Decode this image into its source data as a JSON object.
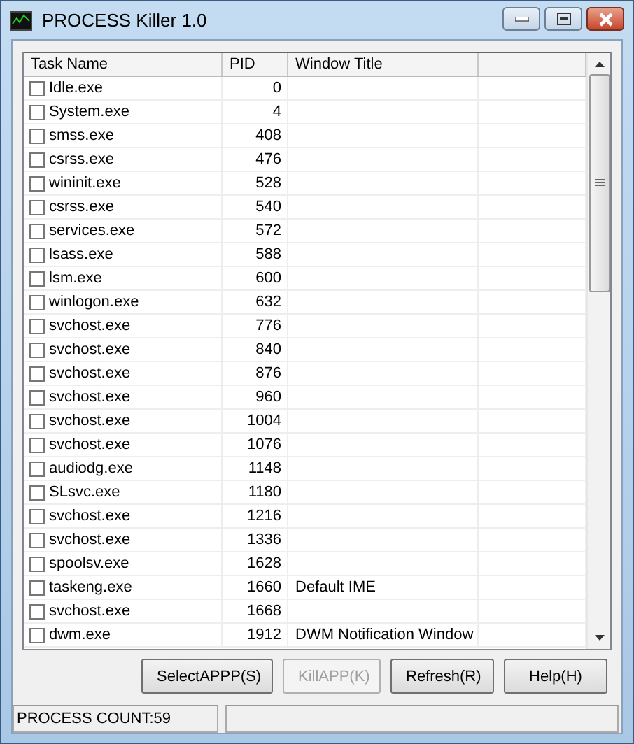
{
  "window": {
    "title": "PROCESS Killer 1.0"
  },
  "table": {
    "columns": [
      "Task Name",
      "PID",
      "Window Title"
    ],
    "rows": [
      {
        "name": "Idle.exe",
        "pid": "0",
        "title": "",
        "checked": false
      },
      {
        "name": "System.exe",
        "pid": "4",
        "title": "",
        "checked": false
      },
      {
        "name": "smss.exe",
        "pid": "408",
        "title": "",
        "checked": false
      },
      {
        "name": "csrss.exe",
        "pid": "476",
        "title": "",
        "checked": false
      },
      {
        "name": "wininit.exe",
        "pid": "528",
        "title": "",
        "checked": false
      },
      {
        "name": "csrss.exe",
        "pid": "540",
        "title": "",
        "checked": false
      },
      {
        "name": "services.exe",
        "pid": "572",
        "title": "",
        "checked": false
      },
      {
        "name": "lsass.exe",
        "pid": "588",
        "title": "",
        "checked": false
      },
      {
        "name": "lsm.exe",
        "pid": "600",
        "title": "",
        "checked": false
      },
      {
        "name": "winlogon.exe",
        "pid": "632",
        "title": "",
        "checked": false
      },
      {
        "name": "svchost.exe",
        "pid": "776",
        "title": "",
        "checked": false
      },
      {
        "name": "svchost.exe",
        "pid": "840",
        "title": "",
        "checked": false
      },
      {
        "name": "svchost.exe",
        "pid": "876",
        "title": "",
        "checked": false
      },
      {
        "name": "svchost.exe",
        "pid": "960",
        "title": "",
        "checked": false
      },
      {
        "name": "svchost.exe",
        "pid": "1004",
        "title": "",
        "checked": false
      },
      {
        "name": "svchost.exe",
        "pid": "1076",
        "title": "",
        "checked": false
      },
      {
        "name": "audiodg.exe",
        "pid": "1148",
        "title": "",
        "checked": false
      },
      {
        "name": "SLsvc.exe",
        "pid": "1180",
        "title": "",
        "checked": false
      },
      {
        "name": "svchost.exe",
        "pid": "1216",
        "title": "",
        "checked": false
      },
      {
        "name": "svchost.exe",
        "pid": "1336",
        "title": "",
        "checked": false
      },
      {
        "name": "spoolsv.exe",
        "pid": "1628",
        "title": "",
        "checked": false
      },
      {
        "name": "taskeng.exe",
        "pid": "1660",
        "title": "Default IME",
        "checked": false
      },
      {
        "name": "svchost.exe",
        "pid": "1668",
        "title": "",
        "checked": false
      },
      {
        "name": "dwm.exe",
        "pid": "1912",
        "title": "DWM Notification Window",
        "checked": false
      }
    ]
  },
  "buttons": [
    {
      "label": "SelectAPPP(S)",
      "disabled": false
    },
    {
      "label": "KillAPP(K)",
      "disabled": true
    },
    {
      "label": "Refresh(R)",
      "disabled": false
    },
    {
      "label": "Help(H)",
      "disabled": false
    }
  ],
  "status_bar": [
    "PROCESS COUNT:59"
  ]
}
